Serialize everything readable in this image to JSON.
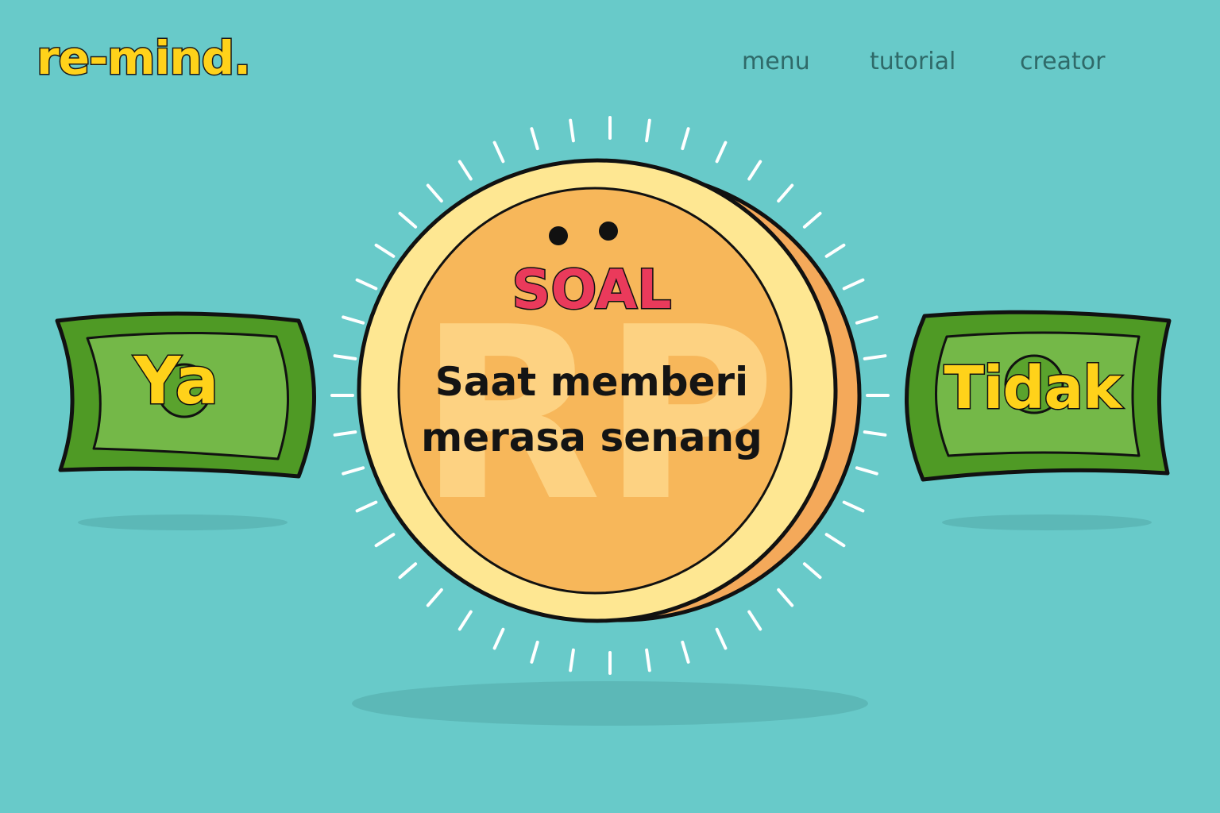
{
  "header": {
    "logo": "re-mind.",
    "nav": [
      {
        "label": "menu"
      },
      {
        "label": "tutorial"
      },
      {
        "label": "creator"
      }
    ]
  },
  "coin": {
    "watermark": "RP",
    "title": "SOAL",
    "question_lines": [
      "Saat memberi",
      "merasa senang"
    ]
  },
  "answers": {
    "yes_label": "Ya",
    "no_label": "Tidak"
  },
  "colors": {
    "background": "#68cac9",
    "accent_yellow": "#ffd21a",
    "title_red": "#ea3a5b",
    "banknote_green": "#4f9a25",
    "coin_rim": "#fee792",
    "coin_face": "#f7b75a"
  }
}
